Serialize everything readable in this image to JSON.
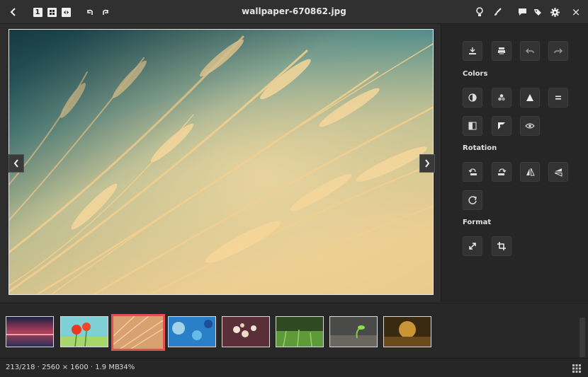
{
  "window": {
    "title": "wallpaper-670862.jpg"
  },
  "toolbar_left": {
    "back_icon": "chevron-left-icon",
    "view_modes": [
      "1",
      "⊞",
      "◧"
    ],
    "rotate_left_icon": "rotate-left-icon",
    "rotate_right_icon": "rotate-right-icon"
  },
  "toolbar_right": {
    "icons": [
      "bulb-icon",
      "brush-icon",
      "chat-icon",
      "tags-icon",
      "gear-icon",
      "close-icon"
    ],
    "close_glyph": "×"
  },
  "side_panel": {
    "top_tools": [
      "save-icon",
      "print-icon",
      "undo-icon",
      "redo-icon"
    ],
    "sections": [
      {
        "label": "Colors"
      },
      {
        "label": "Rotation"
      },
      {
        "label": "Format"
      }
    ]
  },
  "filmstrip": {
    "thumbnails": [
      "sunset-sea",
      "red-poppies",
      "golden-grass",
      "blue-bokeh",
      "blossoms",
      "green-field",
      "sprout",
      "golden-light"
    ],
    "selected_index": 2
  },
  "status": {
    "info": "213/218 · 2560 × 1600 · 1.9 MB",
    "zoom": "34%"
  },
  "colors": {
    "selected_border": "#e05252",
    "background": "#2b2b2b"
  }
}
